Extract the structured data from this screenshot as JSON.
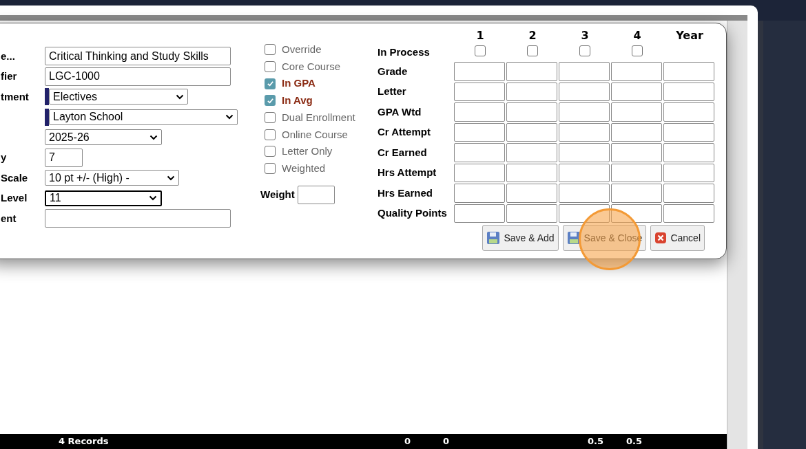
{
  "form_fields": [
    {
      "label": "e...",
      "kind": "text",
      "value": "Critical Thinking and Study Skills",
      "required": false
    },
    {
      "label": "fier",
      "kind": "text",
      "value": "LGC-1000",
      "required": false
    },
    {
      "label": "tment",
      "kind": "select",
      "value": "Electives",
      "required": true
    },
    {
      "kind": "select",
      "value": "Layton School",
      "required": true
    },
    {
      "kind": "select",
      "value": "2025-26",
      "required": false
    },
    {
      "label": "y",
      "kind": "short",
      "value": "7",
      "required": false
    },
    {
      "label": "Scale",
      "kind": "select",
      "value": "10 pt +/- (High) -",
      "required": false
    },
    {
      "label": "Level",
      "kind": "select",
      "value": "11",
      "required": false
    },
    {
      "label": "ent",
      "kind": "text",
      "required": false
    }
  ],
  "options": [
    {
      "label": "Override",
      "checked": false
    },
    {
      "label": "Core Course",
      "checked": false
    },
    {
      "label": "In GPA",
      "checked": true
    },
    {
      "label": "In Avg",
      "checked": true
    },
    {
      "label": "Dual Enrollment",
      "checked": false
    },
    {
      "label": "Online Course",
      "checked": false
    },
    {
      "label": "Letter Only",
      "checked": false
    },
    {
      "label": "Weighted",
      "checked": false
    }
  ],
  "weight": {
    "label": "Weight"
  },
  "grades": {
    "columns": [
      "1",
      "2",
      "3",
      "4",
      "Year"
    ],
    "in_process": {
      "label": "In Process",
      "terms": [
        {
          "checked": false
        },
        {
          "checked": false
        },
        {
          "checked": false
        },
        {
          "checked": false
        }
      ]
    },
    "rows": [
      "Grade",
      "Letter",
      "GPA Wtd",
      "Cr Attempt",
      "Cr Earned",
      "Hrs Attempt",
      "Hrs Earned",
      "Quality Points"
    ]
  },
  "buttons": [
    {
      "label": "Save & Add",
      "kind": "save"
    },
    {
      "label": "Save & Close",
      "kind": "save"
    },
    {
      "label": "Cancel",
      "kind": "cancel"
    }
  ],
  "footer": {
    "records": "4 Records",
    "totals": [
      "0",
      "0",
      "0.5",
      "0.5"
    ]
  }
}
